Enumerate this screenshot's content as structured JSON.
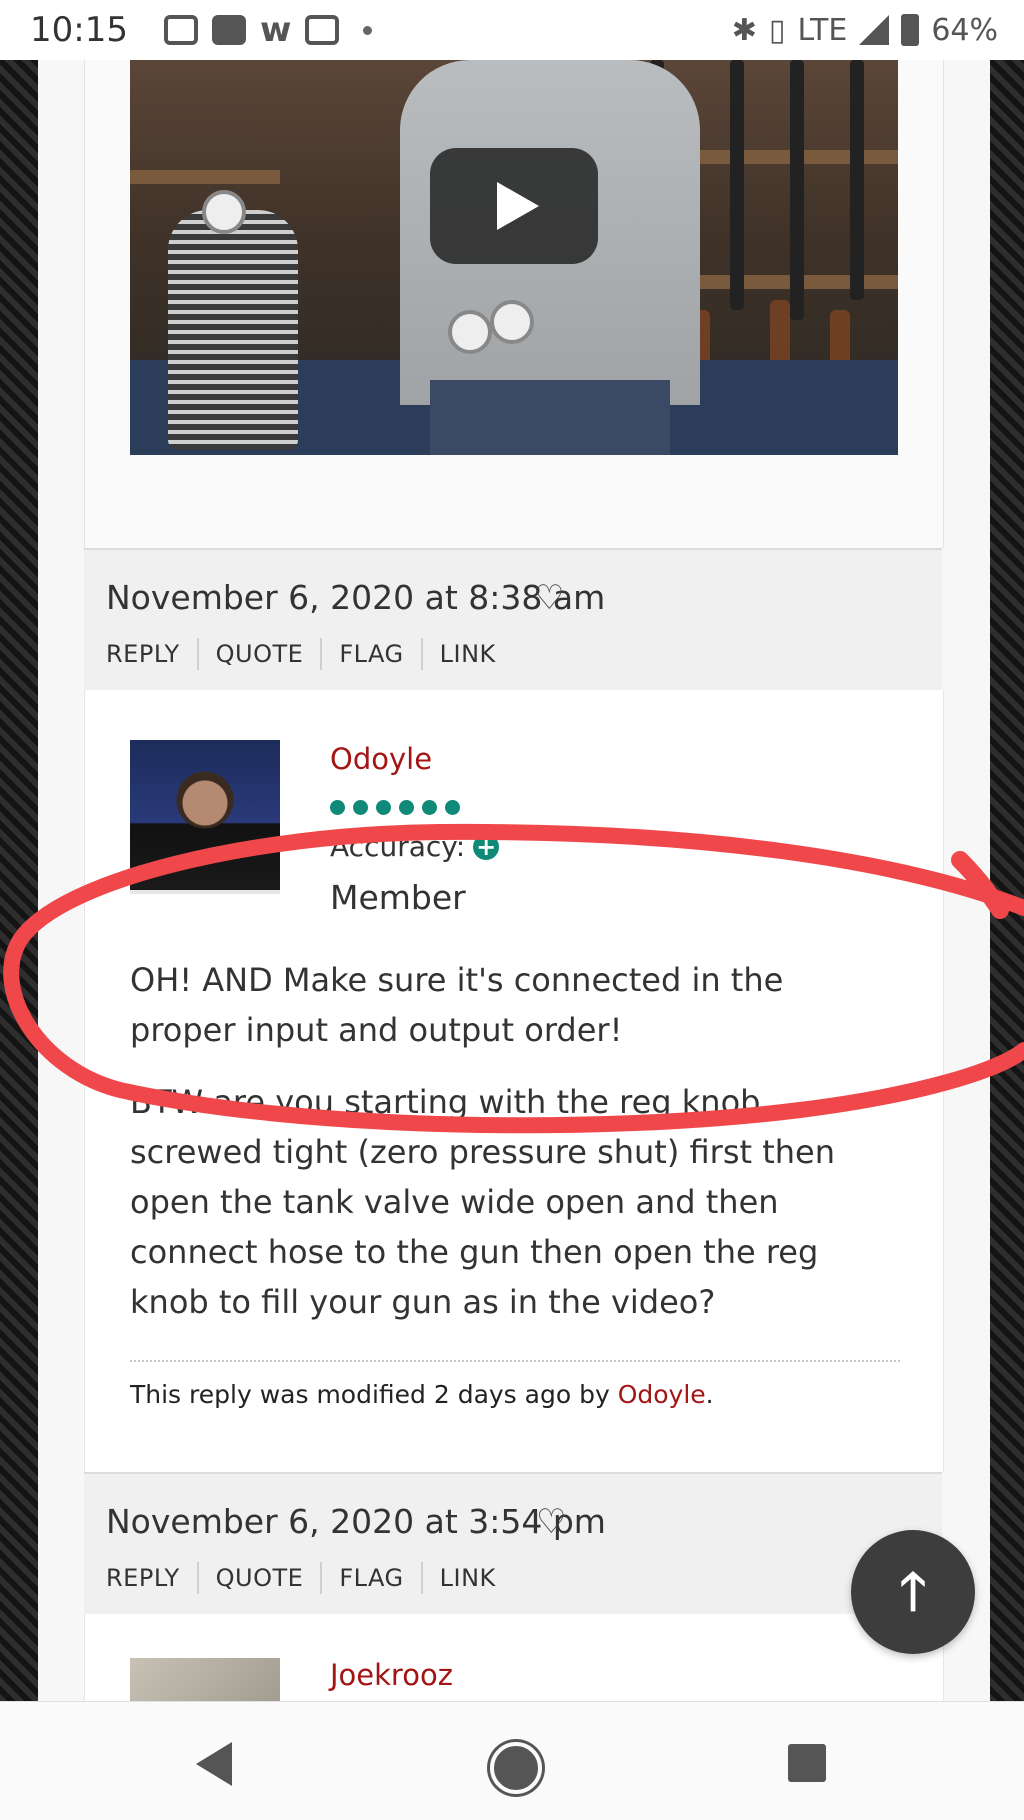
{
  "status_bar": {
    "time": "10:15",
    "network": "LTE",
    "battery": "64%"
  },
  "posts": [
    {
      "date": "November 6, 2020 at 8:38 am",
      "actions": [
        "REPLY",
        "QUOTE",
        "FLAG",
        "LINK"
      ]
    },
    {
      "date": "November 6, 2020 at 3:54 pm",
      "actions": [
        "REPLY",
        "QUOTE",
        "FLAG",
        "LINK"
      ]
    }
  ],
  "reply": {
    "author": "Odoyle",
    "accuracy_label": "Accuracy:",
    "role": "Member",
    "paragraphs": [
      "OH! AND Make sure it's connected in the proper input and output order!",
      "BTW are you starting with the reg knob screwed tight (zero pressure shut) first then open the tank valve wide open and then connect hose to the gun then open the reg knob to fill your gun as in the video?"
    ],
    "modified_prefix": "This reply was modified 2 days ago by ",
    "modified_by": "Odoyle",
    "modified_suffix": "."
  },
  "next_reply": {
    "author": "Joekrooz"
  },
  "colors": {
    "author_link": "#a31515",
    "accuracy_green": "#0f8a78",
    "annotation_red": "#f0484a"
  },
  "icons": {
    "heart": "heart-icon",
    "play": "play-icon",
    "scroll_top": "arrow-up-icon"
  }
}
